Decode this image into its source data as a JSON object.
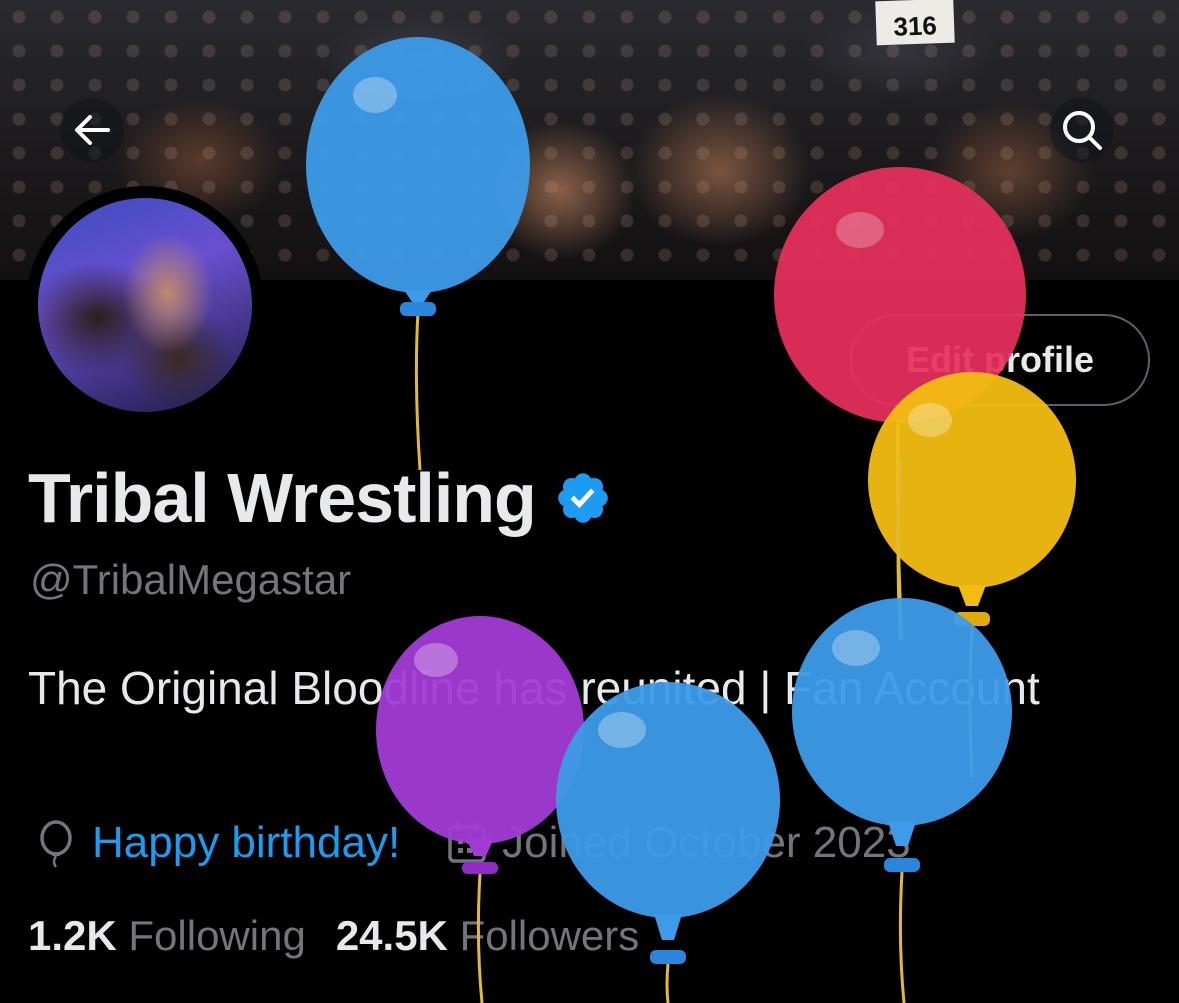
{
  "banner": {
    "sign_text": "316"
  },
  "nav": {
    "back_icon": "arrow-left-icon",
    "search_icon": "search-icon"
  },
  "profile": {
    "name": "Tribal Wrestling",
    "verified_icon": "verified-badge-icon",
    "handle": "@TribalMegastar",
    "bio": "The Original Bloodline has reunited | Fan Account",
    "birthday_icon": "balloon-icon",
    "birthday_text": "Happy birthday!",
    "joined_icon": "calendar-icon",
    "joined_text": "Joined October 2023",
    "edit_button": "Edit profile"
  },
  "stats": {
    "following_count": "1.2K",
    "following_label": "Following",
    "followers_count": "24.5K",
    "followers_label": "Followers"
  },
  "colors": {
    "background": "#000000",
    "text_primary": "#e7e9ea",
    "text_secondary": "#71767b",
    "accent_blue": "#1d9bf0",
    "verified_blue": "#1d9bf0",
    "balloon_blue": "#3d9be9",
    "balloon_red": "#e8305d",
    "balloon_yellow": "#f2bd12",
    "balloon_purple": "#a23bd6"
  }
}
